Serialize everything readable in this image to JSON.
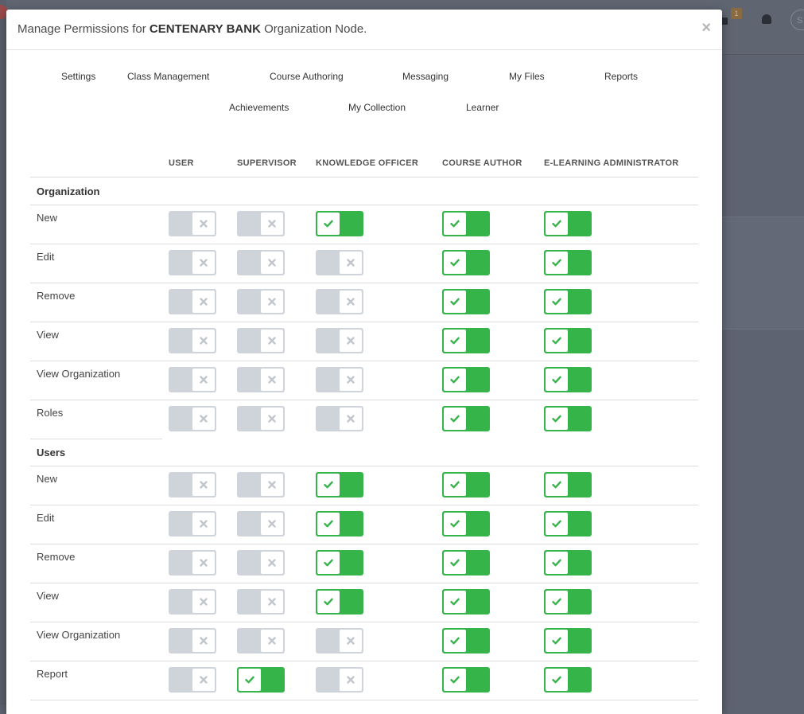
{
  "background": {
    "notification_badge": "1",
    "search_hint": "S"
  },
  "modal": {
    "title_prefix": "Manage Permissions for ",
    "title_bold": "CENTENARY BANK",
    "title_suffix": " Organization Node.",
    "close_label": "×"
  },
  "tabs": [
    {
      "label": "Settings"
    },
    {
      "label": "Class Management"
    },
    {
      "label": "Course Authoring"
    },
    {
      "label": "Messaging"
    },
    {
      "label": "My Files"
    },
    {
      "label": "Reports"
    },
    {
      "label": "Achievements"
    },
    {
      "label": "My Collection"
    },
    {
      "label": "Learner"
    }
  ],
  "columns": [
    "USER",
    "SUPERVISOR",
    "KNOWLEDGE OFFICER",
    "COURSE AUTHOR",
    "E-LEARNING ADMINISTRATOR"
  ],
  "sections": [
    {
      "title": "Organization",
      "rows": [
        {
          "label": "New",
          "values": [
            false,
            false,
            true,
            true,
            true
          ]
        },
        {
          "label": "Edit",
          "values": [
            false,
            false,
            false,
            true,
            true
          ]
        },
        {
          "label": "Remove",
          "values": [
            false,
            false,
            false,
            true,
            true
          ]
        },
        {
          "label": "View",
          "values": [
            false,
            false,
            false,
            true,
            true
          ]
        },
        {
          "label": "View Organization",
          "values": [
            false,
            false,
            false,
            true,
            true
          ]
        },
        {
          "label": "Roles",
          "values": [
            false,
            false,
            false,
            true,
            true
          ]
        }
      ]
    },
    {
      "title": "Users",
      "rows": [
        {
          "label": "New",
          "values": [
            false,
            false,
            true,
            true,
            true
          ]
        },
        {
          "label": "Edit",
          "values": [
            false,
            false,
            true,
            true,
            true
          ]
        },
        {
          "label": "Remove",
          "values": [
            false,
            false,
            true,
            true,
            true
          ]
        },
        {
          "label": "View",
          "values": [
            false,
            false,
            true,
            true,
            true
          ]
        },
        {
          "label": "View Organization",
          "values": [
            false,
            false,
            false,
            true,
            true
          ]
        },
        {
          "label": "Report",
          "values": [
            false,
            true,
            false,
            true,
            true
          ]
        }
      ]
    }
  ],
  "colors": {
    "on": "#35b44a",
    "off": "#cfd3da",
    "x_icon": "#c2c6cd"
  }
}
